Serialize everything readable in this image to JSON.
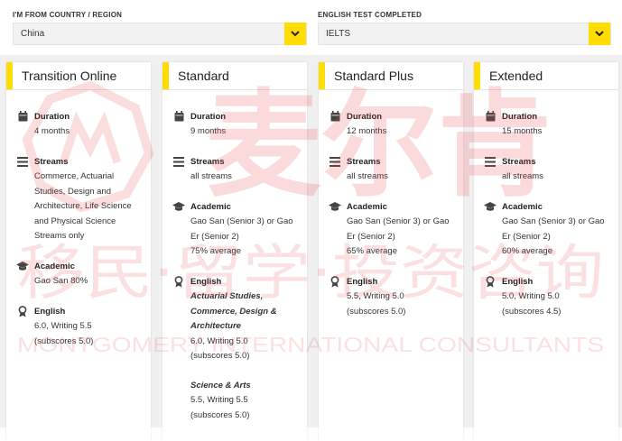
{
  "filters": {
    "country": {
      "label": "I'M FROM COUNTRY / REGION",
      "value": "China"
    },
    "test": {
      "label": "ENGLISH TEST COMPLETED",
      "value": "IELTS"
    }
  },
  "cards": [
    {
      "title": "Transition Online",
      "duration": {
        "label": "Duration",
        "value": "4 months"
      },
      "streams": {
        "label": "Streams",
        "lines": [
          "Commerce, Actuarial",
          "Studies, Design and",
          "Architecture, Life Science",
          "and Physical Science",
          "Streams only"
        ]
      },
      "academic": {
        "label": "Academic",
        "lines": [
          "Gao San 80%"
        ]
      },
      "english": {
        "label": "English",
        "lines": [
          "6.0, Writing 5.5",
          "(subscores 5.0)"
        ]
      }
    },
    {
      "title": "Standard",
      "duration": {
        "label": "Duration",
        "value": "9 months"
      },
      "streams": {
        "label": "Streams",
        "lines": [
          "all streams"
        ]
      },
      "academic": {
        "label": "Academic",
        "lines": [
          "Gao San (Senior 3) or Gao",
          "Er (Senior 2)",
          "75% average"
        ]
      },
      "english": {
        "label": "English",
        "groups": [
          {
            "subtitle": [
              "Actuarial Studies,",
              "Commerce, Design &",
              "Architecture"
            ],
            "lines": [
              "6.0, Writing 5.0",
              "(subscores 5.0)"
            ]
          },
          {
            "subtitle": [
              "Science & Arts"
            ],
            "lines": [
              "5.5, Writing 5.5",
              "(subscores 5.0)"
            ]
          }
        ]
      }
    },
    {
      "title": "Standard Plus",
      "duration": {
        "label": "Duration",
        "value": "12 months"
      },
      "streams": {
        "label": "Streams",
        "lines": [
          "all streams"
        ]
      },
      "academic": {
        "label": "Academic",
        "lines": [
          "Gao San (Senior 3) or Gao",
          "Er (Senior 2)",
          "65% average"
        ]
      },
      "english": {
        "label": "English",
        "lines": [
          "5.5, Writing 5.0",
          "(subscores 5.0)"
        ]
      }
    },
    {
      "title": "Extended",
      "duration": {
        "label": "Duration",
        "value": "15 months"
      },
      "streams": {
        "label": "Streams",
        "lines": [
          "all streams"
        ]
      },
      "academic": {
        "label": "Academic",
        "lines": [
          "Gao San (Senior 3) or Gao",
          "Er (Senior 2)",
          "60% average"
        ]
      },
      "english": {
        "label": "English",
        "lines": [
          "5.0, Writing 5.0",
          "(subscores 4.5)"
        ]
      }
    }
  ],
  "watermark": {
    "brand_cn": "麦尔肯",
    "slogan_cn": "移民·留学·投资咨询",
    "brand_en": "MONTGOMERY INTERNATIONAL CONSULTANTS"
  },
  "colors": {
    "accent": "#ffdd00",
    "watermark": "#e8464b"
  },
  "icons": {
    "duration": "calendar-icon",
    "streams": "list-icon",
    "academic": "graduation-cap-icon",
    "english": "award-icon"
  }
}
